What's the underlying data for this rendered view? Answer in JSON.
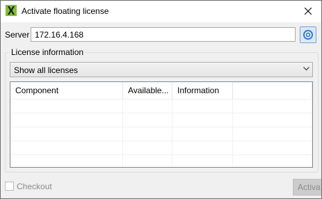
{
  "window": {
    "title": "Activate floating license",
    "icon": "x-app-icon",
    "close_icon": "close-icon"
  },
  "server": {
    "label": "Server",
    "value": "172.16.4.168",
    "connect_icon": "connect-icon"
  },
  "license_info": {
    "group_title": "License information",
    "filter": {
      "selected": "Show all licenses",
      "icon": "chevron-down-icon"
    },
    "table": {
      "columns": [
        "Component",
        "Available...",
        "Information",
        ""
      ],
      "rows": []
    }
  },
  "footer": {
    "checkout_label": "Checkout",
    "checkout_checked": false,
    "activate_label": "Activa"
  },
  "colors": {
    "title_bar": "#ffffff",
    "window_bg": "#f0f0f0",
    "disabled_text": "#8b8b8b",
    "connect_button": "#3a7fd5"
  }
}
